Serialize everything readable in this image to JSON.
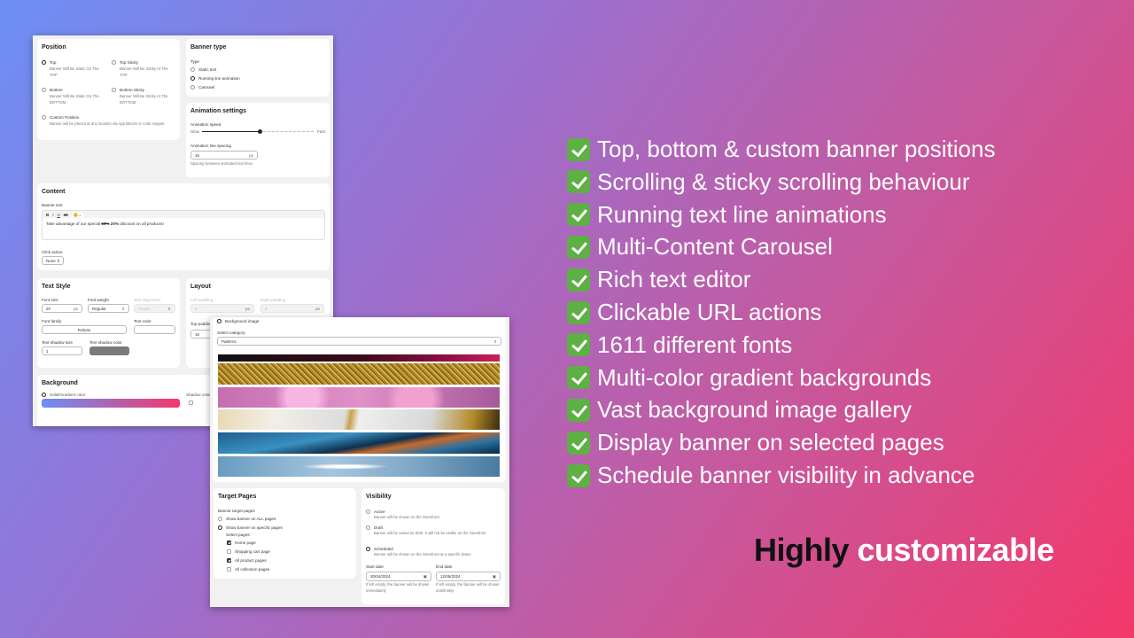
{
  "position": {
    "title": "Position",
    "options": [
      {
        "label": "Top",
        "desc": "Banner Will Be Static On The TOP",
        "selected": true
      },
      {
        "label": "Top Sticky",
        "desc": "Banner Will Be Sticky At The TOP",
        "selected": false
      },
      {
        "label": "Bottom",
        "desc": "Banner Will Be Static On The BOTTOM",
        "selected": false
      },
      {
        "label": "Bottom Sticky",
        "desc": "Banner Will Be Sticky At The BOTTOM",
        "selected": false
      },
      {
        "label": "Custom Position",
        "desc": "Banner will be placed at any location via App Blocks or code snippet",
        "selected": false
      }
    ]
  },
  "banner_type": {
    "title": "Banner type",
    "type_label": "Type",
    "options": [
      "Static text",
      "Running line animation",
      "Carousel"
    ],
    "selected": "Running line animation"
  },
  "animation": {
    "title": "Animation settings",
    "speed_label": "Animation speed",
    "slow": "Slow",
    "fast": "Fast",
    "speed_value": 0.52,
    "spacing_label": "Animation line spacing",
    "spacing_value": "16",
    "unit": "px",
    "spacing_help": "Spacing between animated text lines"
  },
  "content": {
    "title": "Content",
    "banner_text_label": "Banner text",
    "toolbar": [
      "B",
      "I",
      "U",
      "ab"
    ],
    "text_before": "Take advantage of our special ",
    "text_strike": "10%",
    "text_bold": " 20%",
    "text_after": " discount on all products!",
    "click_action_label": "Click action",
    "click_action_value": "None"
  },
  "text_style": {
    "title": "Text Style",
    "font_size_label": "Font size",
    "font_size": "20",
    "unit": "px",
    "font_weight_label": "Font weight",
    "font_weight": "Regular",
    "align_label": "Text Alignment",
    "align": "Center",
    "font_family_label": "Font family",
    "font_family": "Roboto",
    "text_color_label": "Text color",
    "shadow_size_label": "Text shadow size",
    "shadow_size": "1",
    "shadow_color_label": "Text shadow color",
    "shadow_color": "#7a7a7a"
  },
  "layout": {
    "title": "Layout",
    "left_label": "Left padding",
    "left": "0",
    "right_label": "Right padding",
    "right": "0",
    "top_label": "Top padding",
    "top": "16",
    "unit": "px"
  },
  "background": {
    "title": "Background",
    "solid_label": "Solid/Gradient color",
    "shadow_label": "Shadow color",
    "gradient": [
      "#6b8ff7",
      "#f3386a"
    ],
    "image_label": "Background image",
    "category_label": "Select category",
    "category": "Patterns"
  },
  "target_pages": {
    "title": "Target Pages",
    "label": "Banner target pages",
    "all": "Show banner on ALL pages",
    "specific": "Show banner on specific pages",
    "select_label": "Select pages:",
    "pages": [
      {
        "label": "Home page",
        "checked": true
      },
      {
        "label": "Shopping cart page",
        "checked": false
      },
      {
        "label": "All product pages",
        "checked": true
      },
      {
        "label": "All collection pages",
        "checked": false
      }
    ]
  },
  "visibility": {
    "title": "Visibility",
    "options": [
      {
        "label": "Active",
        "desc": "Banner will be shown on the Storefront",
        "selected": false
      },
      {
        "label": "Draft",
        "desc": "Banner will be saved as draft. It will not be visible on the Storefront",
        "selected": false
      },
      {
        "label": "Scheduled",
        "desc": "Banner will be shown on the Storefront at a specific dates",
        "selected": true
      }
    ],
    "start_label": "Start date",
    "start": "30/04/2024",
    "end_label": "End date",
    "end": "12/05/2024",
    "start_help": "If left empty, the banner will be shown immediately",
    "end_help": "If left empty, the banner will be shown indefinitely"
  },
  "features": [
    "Top, bottom & custom banner positions",
    "Scrolling & sticky scrolling behaviour",
    "Running text line animations",
    "Multi-Content Carousel",
    "Rich text editor",
    "Clickable URL actions",
    "1611 different fonts",
    "Multi-color gradient backgrounds",
    "Vast background image gallery",
    "Display banner on selected pages",
    "Schedule banner visibility in advance"
  ],
  "tagline": {
    "dark": "Highly",
    "light": "customizable"
  },
  "colors": {
    "check": "#5db043",
    "bg_start": "#6d8ff5",
    "bg_end": "#f3386a"
  }
}
